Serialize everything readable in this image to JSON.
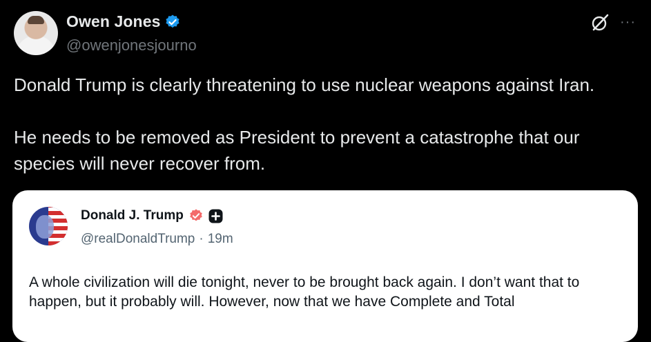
{
  "post": {
    "author": {
      "display_name": "Owen Jones",
      "handle": "@owenjonesjourno",
      "verified": true
    },
    "icons": {
      "avatar": "profile-photo",
      "verified": "verified-badge-icon",
      "grok": "grok-icon",
      "more": "more-icon"
    },
    "more_glyph": "···",
    "text": {
      "paragraph_1": "Donald Trump is clearly threatening to use nuclear weapons against Iran.",
      "paragraph_2": "He needs to be removed as President to prevent a catastrophe that our species will never recover from."
    }
  },
  "quote": {
    "author": {
      "display_name": "Donald J. Trump",
      "handle": "@realDonaldTrump",
      "separator": "·",
      "time_ago": "19m"
    },
    "text": "A whole civilization will die tonight, never to be brought back again. I don’t want that to happen, but it probably will. However, now that we have Complete and Total"
  },
  "colors": {
    "background": "#000000",
    "primary_text": "#e7e9ea",
    "secondary_text": "#71767b",
    "verified_blue": "#1d9bf0",
    "quote_background": "#ffffff",
    "quote_text": "#0f1419",
    "quote_secondary": "#536471",
    "truth_badge": "#f36b6b"
  }
}
